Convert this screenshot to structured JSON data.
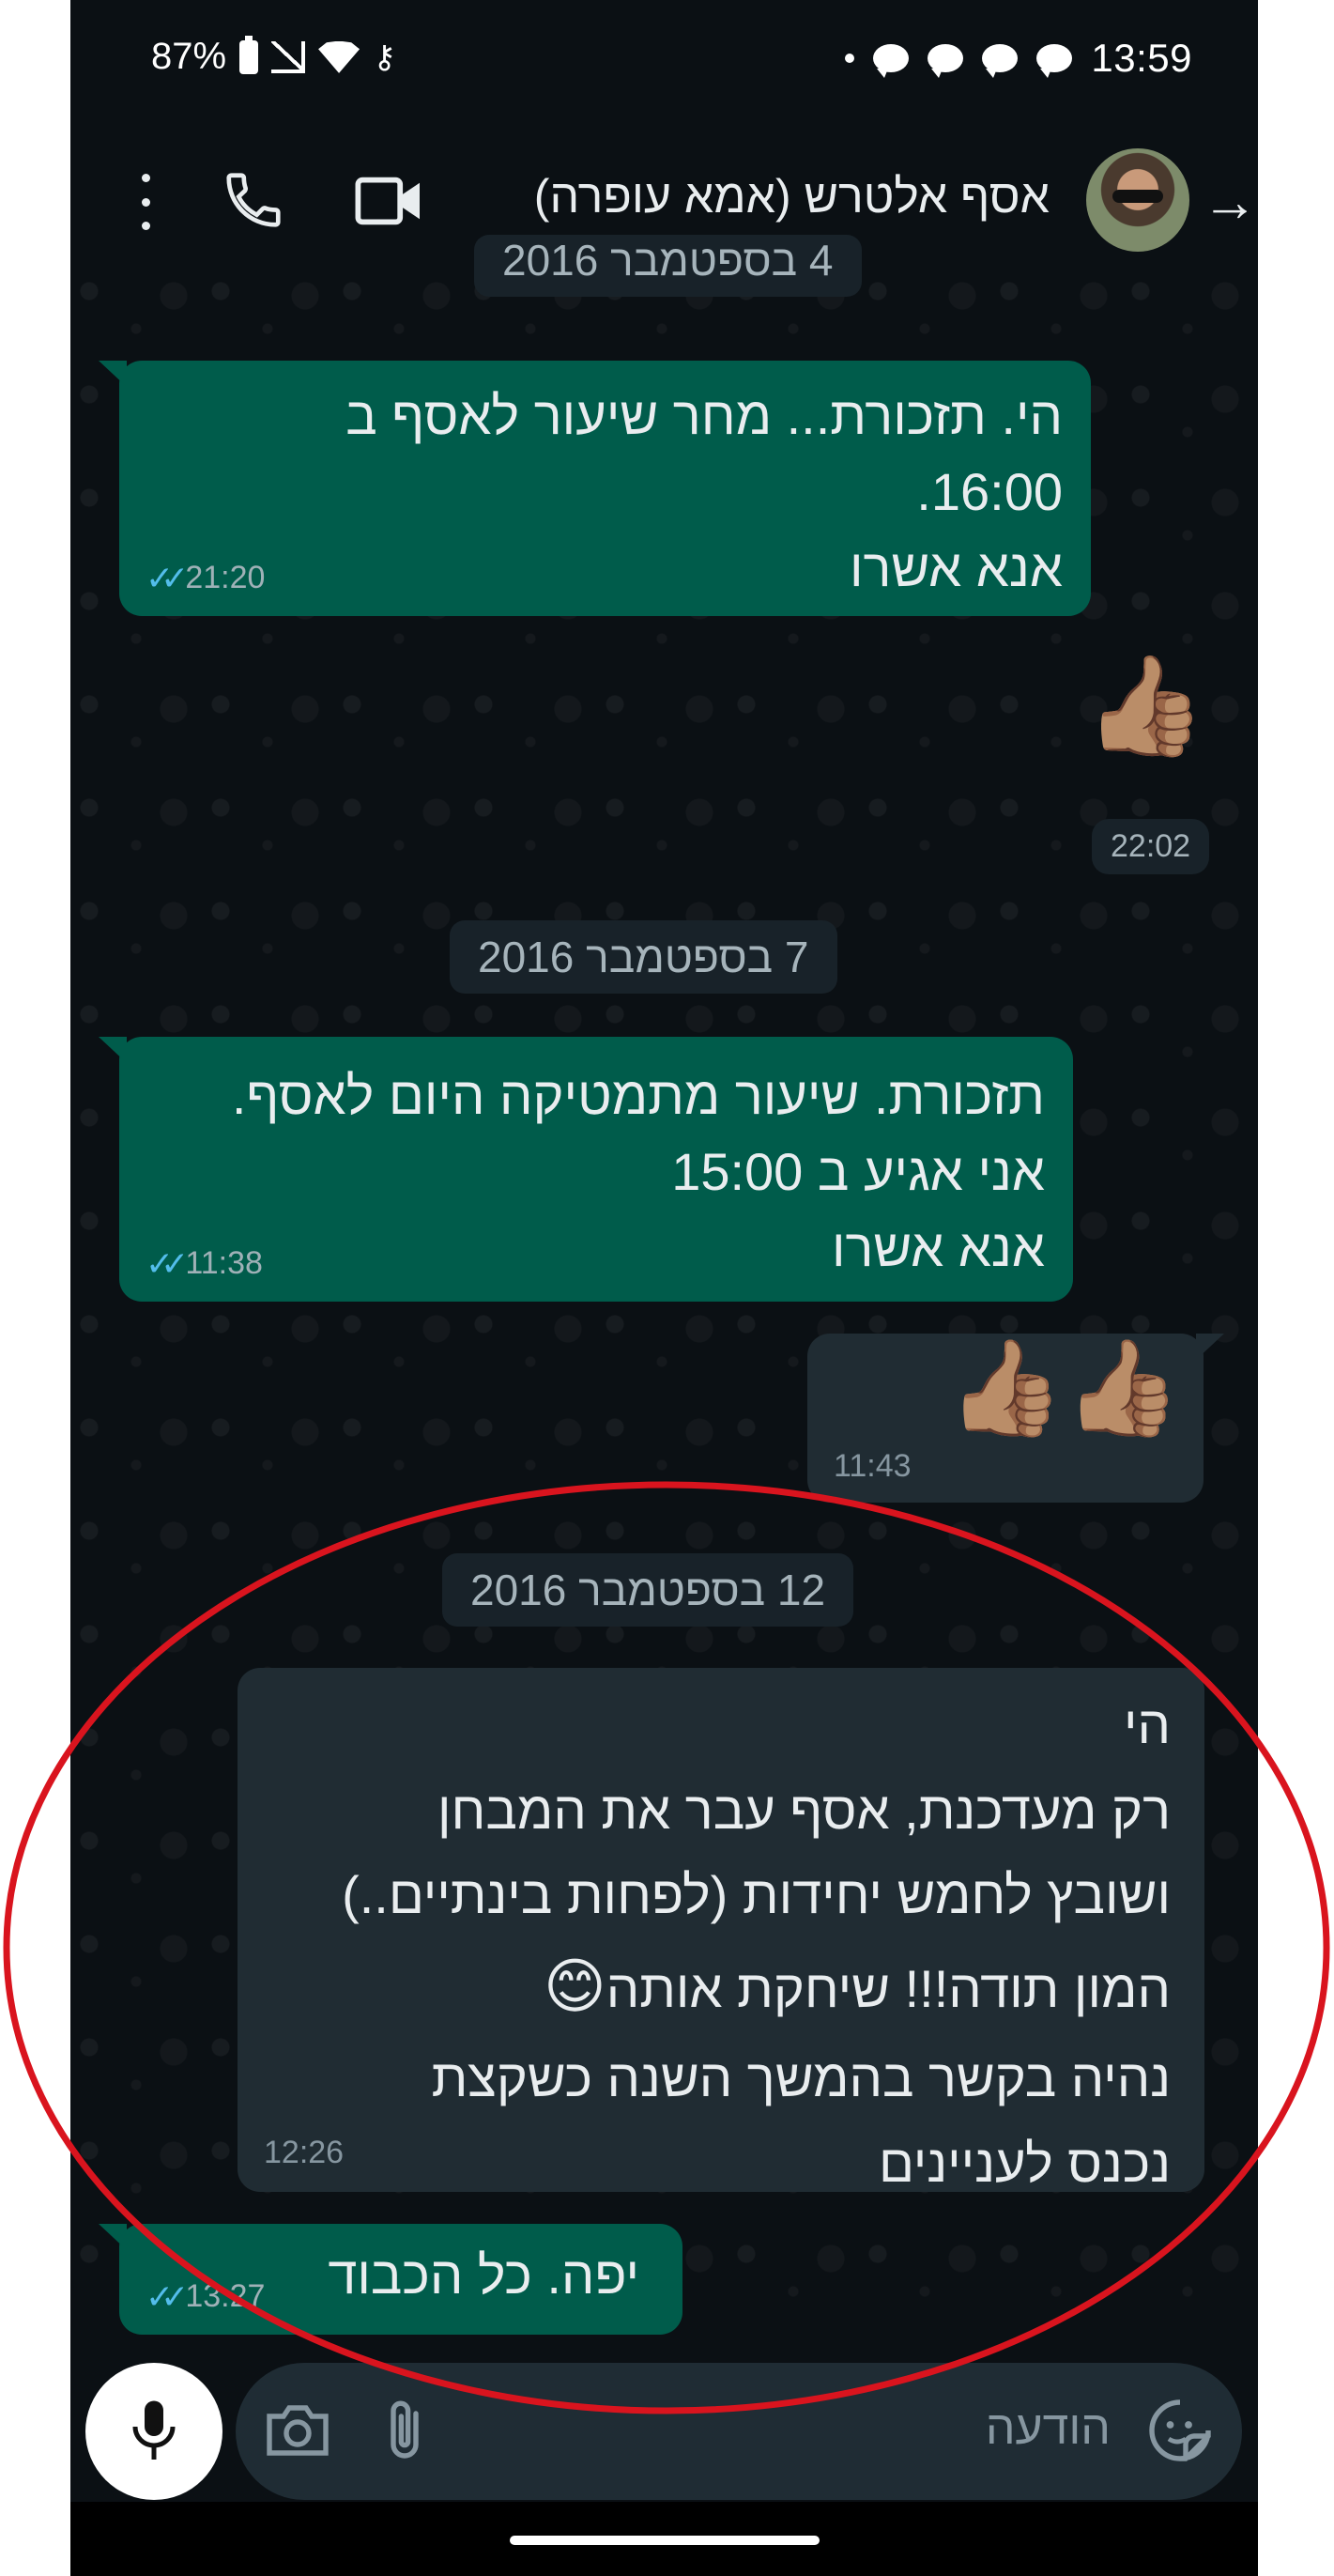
{
  "status_bar": {
    "battery": "87%",
    "time": "13:59",
    "vpn_icon": "key-icon",
    "notification_icons": [
      "chat-bubble-icon",
      "chat-bubble-icon",
      "chat-bubble-icon",
      "chat-bubble-icon"
    ]
  },
  "header": {
    "contact_name": "אסף אלטרש (אמא עופרה)",
    "back_icon": "arrow-right-icon",
    "video_icon": "video-call-icon",
    "call_icon": "phone-icon",
    "menu_icon": "more-vert-icon"
  },
  "chat": {
    "top_date_partial": "4 בספטמבר 2016",
    "messages_1": {
      "lines": [
        "הי. תזכורת... מחר שיעור לאסף ב",
        "16:00.",
        "אנא אשרו"
      ],
      "time": "21:20",
      "ticks": "✓✓"
    },
    "reply_1": {
      "emoji": "👍🏽",
      "time": "22:02"
    },
    "date_2": "7 בספטמבר 2016",
    "messages_2": {
      "lines": [
        "תזכורת. שיעור מתמטיקה היום לאסף.",
        "אני אגיע ב 15:00",
        "אנא אשרו"
      ],
      "time": "11:38",
      "ticks": "✓✓"
    },
    "reply_2": {
      "emoji": "👍🏽👍🏽",
      "time": "11:43"
    },
    "date_3": "12 בספטמבר 2016",
    "incoming_3": {
      "lines": [
        "הי",
        "רק מעדכנת, אסף עבר את המבחן",
        "ושובץ לחמש יחידות (לפחות בינתיים..)",
        "המון תודה!!! שיחקת אותה",
        "נהיה בקשר בהמשך השנה כשקצת",
        "נכנס לעניינים"
      ],
      "emoji": "😊",
      "time": "12:26"
    },
    "outgoing_4": {
      "text": "יפה. כל הכבוד",
      "time": "13:27",
      "ticks": "✓✓"
    }
  },
  "composer": {
    "placeholder": "הודעה",
    "emoji_icon": "sticker-icon",
    "attach_icon": "paperclip-icon",
    "camera_icon": "camera-icon",
    "mic_icon": "microphone-icon"
  },
  "colors": {
    "outgoing_bubble": "#005c4b",
    "incoming_bubble": "#202c33",
    "read_ticks": "#53bdeb",
    "annotation": "#d9141e"
  }
}
